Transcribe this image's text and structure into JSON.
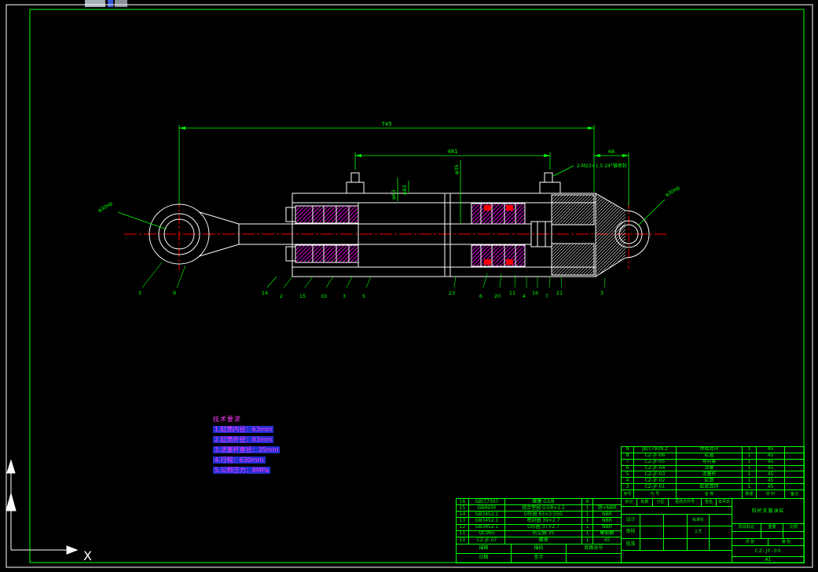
{
  "frame": {
    "axis_x_label": "X"
  },
  "dims": {
    "overall": "745",
    "stroke_span": "481",
    "end_span": "68",
    "port_note": "2-M22×1.5 24°锥密封",
    "bore": "φ63",
    "outer": "φ83",
    "rod": "φ35",
    "left_eye": "φ30H8",
    "right_eye": "φ30H8"
  },
  "callouts": [
    "3",
    "9",
    "14",
    "2",
    "15",
    "10",
    "3",
    "5",
    "23",
    "6",
    "20",
    "11",
    "4",
    "16",
    "7",
    "21",
    "3"
  ],
  "tech": {
    "title": "技术要求",
    "lines": [
      "1.缸筒内径：63mm",
      "2.缸筒外径：83mm",
      "3.活塞杆直径：35mm",
      "4.行程：630mm",
      "5.公称压力：8MPa"
    ]
  },
  "bom_upper": {
    "header": {
      "seq": "序号",
      "code": "代  号",
      "name": "名  称",
      "qty": "数量",
      "mat": "材  料",
      "rem": "备注"
    },
    "rows": [
      {
        "seq": "9",
        "code": "JB/T7939.2",
        "name": "焊接耳环",
        "qty": "1",
        "mat": "45",
        "rem": ""
      },
      {
        "seq": "8",
        "code": "CZ-JF-06",
        "name": "缸盖",
        "qty": "1",
        "mat": "45",
        "rem": ""
      },
      {
        "seq": "7",
        "code": "CZ-JF-05",
        "name": "导向套",
        "qty": "1",
        "mat": "45",
        "rem": ""
      },
      {
        "seq": "6",
        "code": "CZ-JF-04",
        "name": "活塞",
        "qty": "1",
        "mat": "45",
        "rem": ""
      },
      {
        "seq": "5",
        "code": "CZ-JF-03",
        "name": "活塞杆",
        "qty": "1",
        "mat": "45",
        "rem": ""
      },
      {
        "seq": "4",
        "code": "CZ-JF-02",
        "name": "缸筒",
        "qty": "1",
        "mat": "45",
        "rem": ""
      },
      {
        "seq": "3",
        "code": "CZ-JF-01",
        "name": "缸底耳环",
        "qty": "1",
        "mat": "45",
        "rem": ""
      }
    ]
  },
  "bom_lower": {
    "rows": [
      {
        "seq": "16",
        "code": "GB/T7307",
        "name": "螺塞 G3/8",
        "qty": "6",
        "mat": ""
      },
      {
        "seq": "15",
        "code": "GB6930",
        "name": "组合垫圈 G3/8×1.2",
        "qty": "1",
        "mat": "铜+NBR"
      },
      {
        "seq": "14",
        "code": "GB3452.1",
        "name": "O形圈 63×3.55G",
        "qty": "1",
        "mat": "NBR"
      },
      {
        "seq": "13",
        "code": "GB3452.1",
        "name": "密封圈 39×2.7",
        "qty": "1",
        "mat": "NBR"
      },
      {
        "seq": "12",
        "code": "GB3452.1",
        "name": "O形圈 37×2.7",
        "qty": "1",
        "mat": "NBR"
      },
      {
        "seq": "11",
        "code": "QC965",
        "name": "防尘圈 35",
        "qty": "1",
        "mat": "聚氨酯"
      },
      {
        "seq": "10",
        "code": "CZ-JF-07",
        "name": "螺堵",
        "qty": "1",
        "mat": "45"
      }
    ]
  },
  "titleblock": {
    "rev": {
      "c1": "标记",
      "c2": "处数",
      "c3": "分区",
      "c4": "更改文件号",
      "c5": "签名",
      "c6": "年月日"
    },
    "sig": {
      "design": "设计",
      "check": "审核",
      "approve": "批准",
      "standard": "标准化",
      "process": "工艺"
    },
    "stage": "阶段标记",
    "weight": "重量",
    "scale": "比例",
    "sheet_total": "共 张",
    "sheet_no": "第 张",
    "name": "前桥支腿油缸",
    "number": "CZ-JF-00",
    "size": "A1"
  },
  "archive": {
    "c1": "描图",
    "c2": "描校",
    "c3": "底图总号",
    "c4": "日期",
    "c5": "签字",
    "c6": ""
  }
}
